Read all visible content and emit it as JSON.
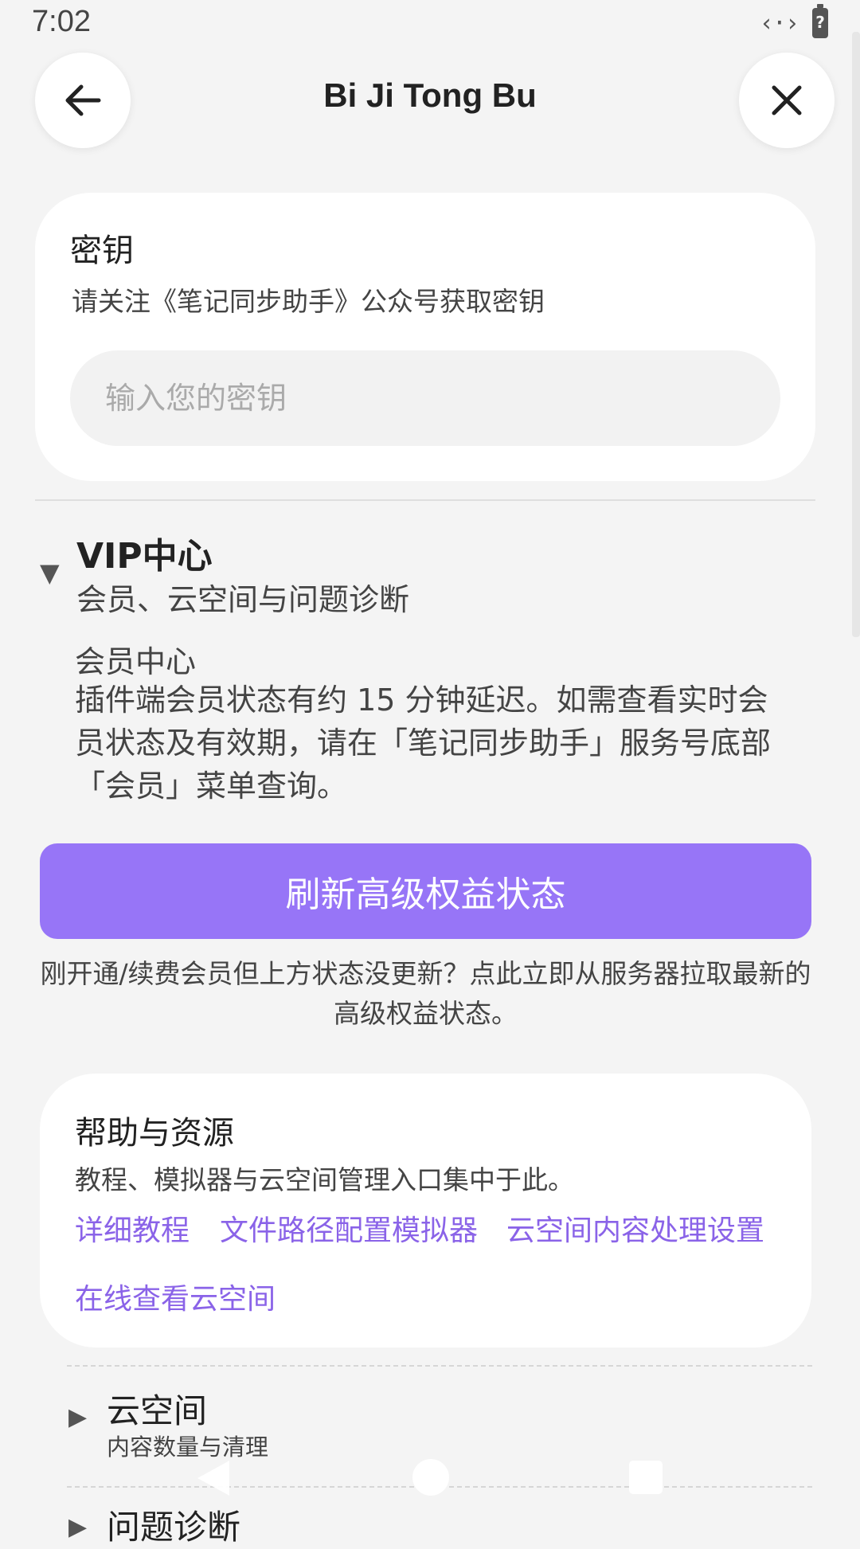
{
  "status_bar": {
    "time": "7:02",
    "signal_icon": "data-transfer-icon",
    "battery_icon": "battery-unknown-icon",
    "battery_glyph": "?"
  },
  "header": {
    "title": "Bi Ji Tong Bu",
    "back_icon": "arrow-left-icon",
    "close_icon": "close-icon"
  },
  "key_section": {
    "title": "密钥",
    "description": "请关注《笔记同步助手》公众号获取密钥",
    "input_placeholder": "输入您的密钥",
    "input_value": ""
  },
  "vip_section": {
    "title": "VIP中心",
    "subtitle": "会员、云空间与问题诊断",
    "member_title": "会员中心",
    "member_description": "插件端会员状态有约 15 分钟延迟。如需查看实时会员状态及有效期，请在「笔记同步助手」服务号底部「会员」菜单查询。",
    "refresh_button": "刷新高级权益状态",
    "refresh_hint": "刚开通/续费会员但上方状态没更新？点此立即从服务器拉取最新的高级权益状态。"
  },
  "help_section": {
    "title": "帮助与资源",
    "description": "教程、模拟器与云空间管理入口集中于此。",
    "links": [
      "详细教程",
      "文件路径配置模拟器",
      "云空间内容处理设置",
      "在线查看云空间"
    ]
  },
  "cloud_section": {
    "title": "云空间",
    "subtitle": "内容数量与清理"
  },
  "diagnosis_section": {
    "title": "问题诊断"
  },
  "colors": {
    "accent": "#9775f7",
    "link": "#8a63e8",
    "background": "#f4f4f4",
    "card": "#ffffff"
  }
}
